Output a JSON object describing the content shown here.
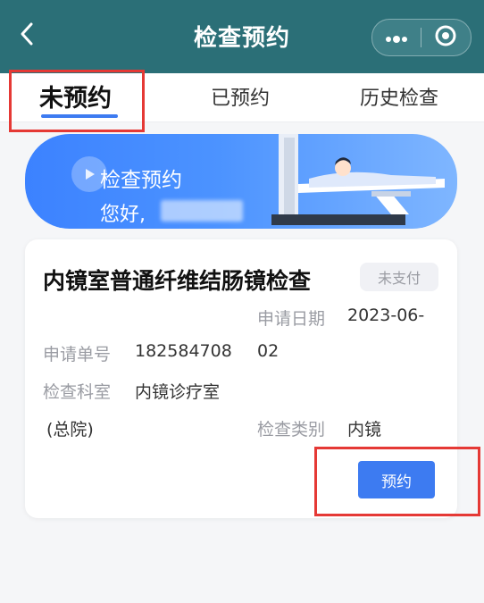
{
  "header": {
    "title": "检查预约"
  },
  "tabs": [
    {
      "label": "未预约",
      "active": true
    },
    {
      "label": "已预约",
      "active": false
    },
    {
      "label": "历史检查",
      "active": false
    }
  ],
  "banner": {
    "title": "检查预约",
    "greeting": "您好,"
  },
  "card": {
    "title": "内镜室普通纤维结肠镜检查",
    "status": "未支付",
    "apply_date_label": "申请日期",
    "apply_date_value_part1": "2023-06-",
    "apply_no_label": "申请单号",
    "apply_no_value": "182584708",
    "apply_date_value_part2": "02",
    "dept_label": "检查科室",
    "dept_value_line1": "内镜诊疗室",
    "dept_value_line2": "(总院)",
    "type_label": "检查类别",
    "type_value": "内镜",
    "book_button": "预约"
  },
  "colors": {
    "header_bg": "#2b6f77",
    "accent_blue": "#3d7bf1",
    "highlight_red": "#e53935"
  },
  "icons": {
    "back": "chevron-left-icon",
    "more": "more-dots-icon",
    "close": "target-circle-icon",
    "banner": "play-circle-icon",
    "illustration": "patient-ct-scanner-illustration"
  }
}
